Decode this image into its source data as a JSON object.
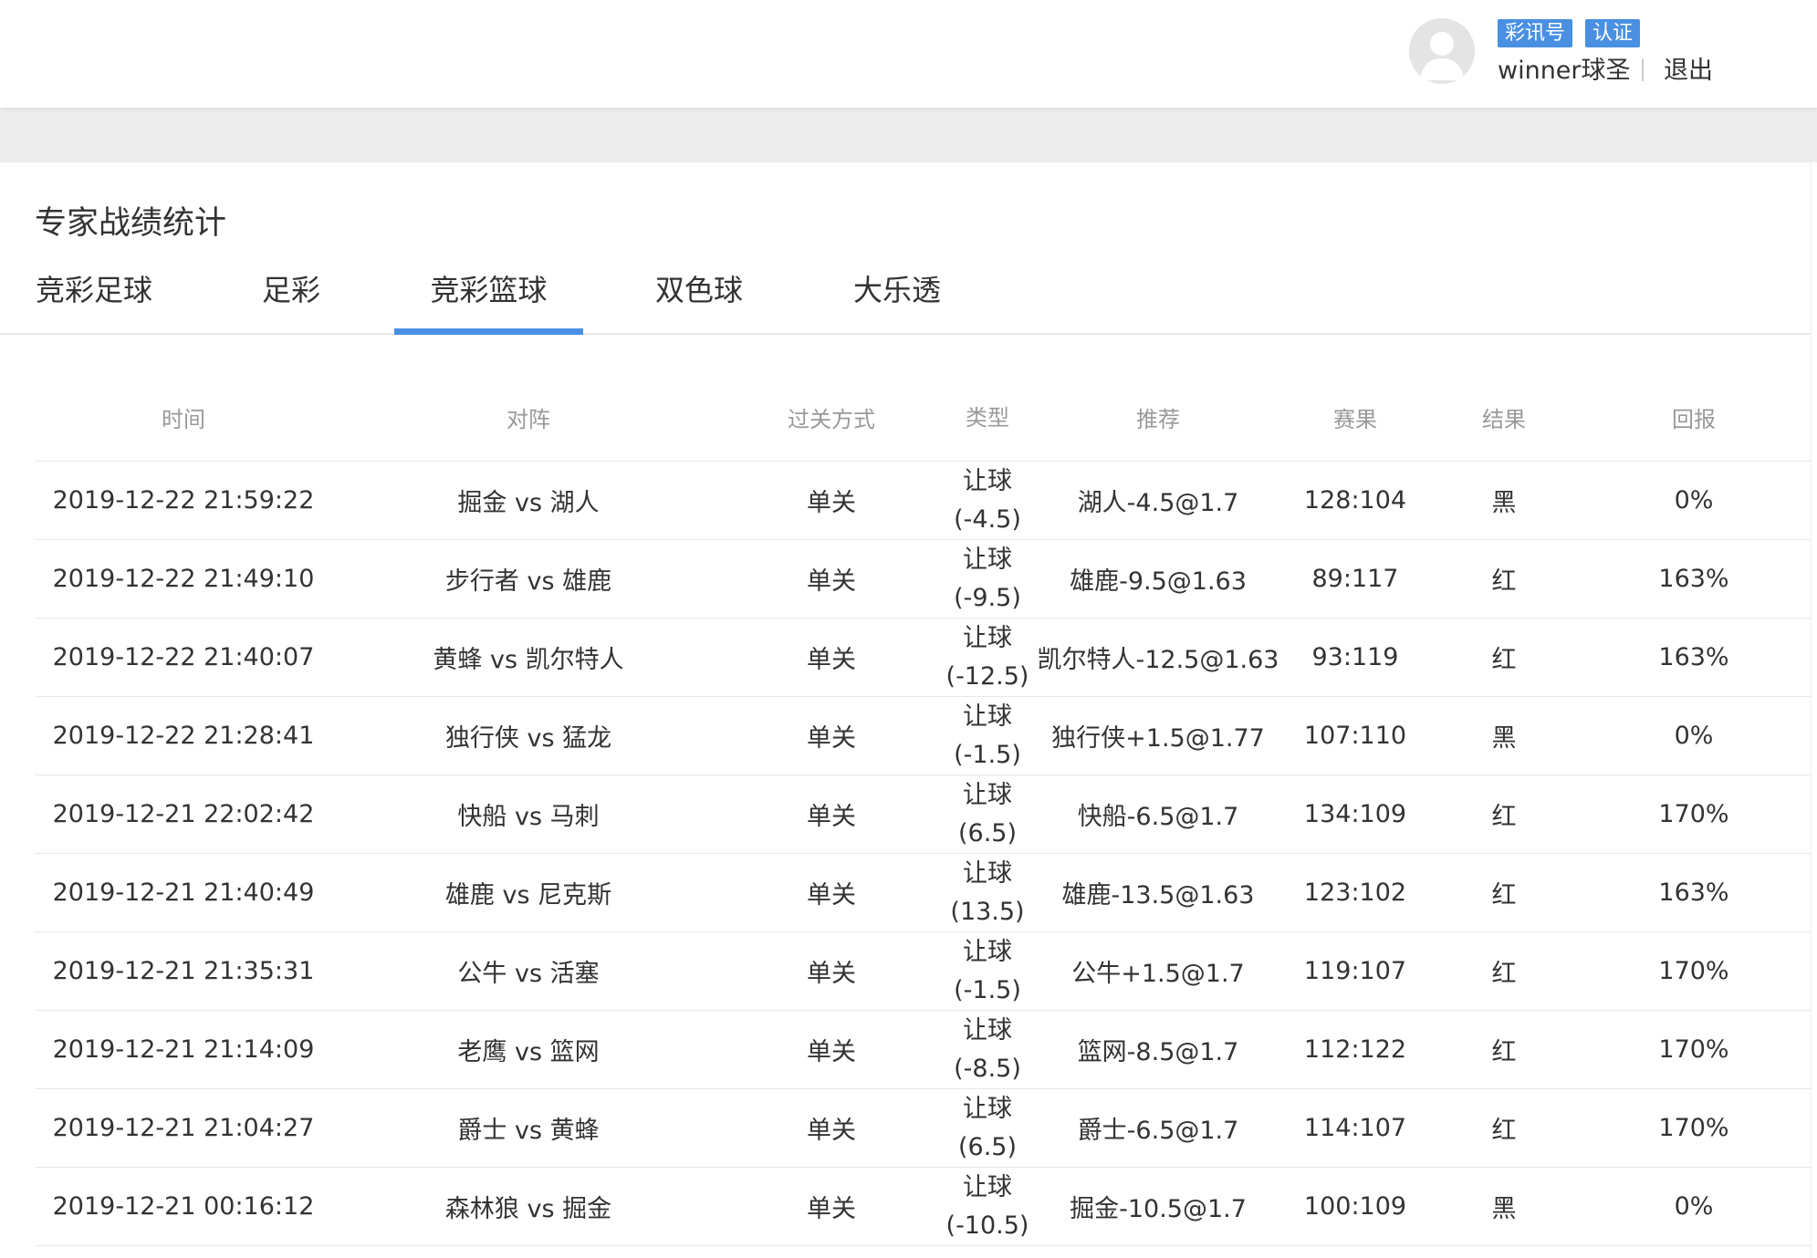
{
  "header": {
    "badges": [
      "彩讯号",
      "认证"
    ],
    "username": "winner球圣",
    "logout": "退出"
  },
  "section": {
    "title": "专家战绩统计"
  },
  "tabs": [
    {
      "label": "竞彩足球",
      "active": false
    },
    {
      "label": "足彩",
      "active": false
    },
    {
      "label": "竞彩篮球",
      "active": true
    },
    {
      "label": "双色球",
      "active": false
    },
    {
      "label": "大乐透",
      "active": false
    }
  ],
  "table": {
    "columns": [
      "时间",
      "对阵",
      "过关方式",
      "类型",
      "推荐",
      "赛果",
      "结果",
      "回报"
    ],
    "rows": [
      {
        "time": "2019-12-22 21:59:22",
        "match": "掘金 vs 湖人",
        "mode": "单关",
        "type": "让球",
        "handicap": "(-4.5)",
        "rec": "湖人-4.5@1.7",
        "score": "128:104",
        "result": "黑",
        "return": "0%"
      },
      {
        "time": "2019-12-22 21:49:10",
        "match": "步行者 vs 雄鹿",
        "mode": "单关",
        "type": "让球",
        "handicap": "(-9.5)",
        "rec": "雄鹿-9.5@1.63",
        "score": "89:117",
        "result": "红",
        "return": "163%"
      },
      {
        "time": "2019-12-22 21:40:07",
        "match": "黄蜂 vs 凯尔特人",
        "mode": "单关",
        "type": "让球",
        "handicap": "(-12.5)",
        "rec": "凯尔特人-12.5@1.63",
        "score": "93:119",
        "result": "红",
        "return": "163%"
      },
      {
        "time": "2019-12-22 21:28:41",
        "match": "独行侠 vs 猛龙",
        "mode": "单关",
        "type": "让球",
        "handicap": "(-1.5)",
        "rec": "独行侠+1.5@1.77",
        "score": "107:110",
        "result": "黑",
        "return": "0%"
      },
      {
        "time": "2019-12-21 22:02:42",
        "match": "快船 vs 马刺",
        "mode": "单关",
        "type": "让球",
        "handicap": "(6.5)",
        "rec": "快船-6.5@1.7",
        "score": "134:109",
        "result": "红",
        "return": "170%"
      },
      {
        "time": "2019-12-21 21:40:49",
        "match": "雄鹿 vs 尼克斯",
        "mode": "单关",
        "type": "让球",
        "handicap": "(13.5)",
        "rec": "雄鹿-13.5@1.63",
        "score": "123:102",
        "result": "红",
        "return": "163%"
      },
      {
        "time": "2019-12-21 21:35:31",
        "match": "公牛 vs 活塞",
        "mode": "单关",
        "type": "让球",
        "handicap": "(-1.5)",
        "rec": "公牛+1.5@1.7",
        "score": "119:107",
        "result": "红",
        "return": "170%"
      },
      {
        "time": "2019-12-21 21:14:09",
        "match": "老鹰 vs 篮网",
        "mode": "单关",
        "type": "让球",
        "handicap": "(-8.5)",
        "rec": "篮网-8.5@1.7",
        "score": "112:122",
        "result": "红",
        "return": "170%"
      },
      {
        "time": "2019-12-21 21:04:27",
        "match": "爵士 vs 黄蜂",
        "mode": "单关",
        "type": "让球",
        "handicap": "(6.5)",
        "rec": "爵士-6.5@1.7",
        "score": "114:107",
        "result": "红",
        "return": "170%"
      },
      {
        "time": "2019-12-21 00:16:12",
        "match": "森林狼 vs 掘金",
        "mode": "单关",
        "type": "让球",
        "handicap": "(-10.5)",
        "rec": "掘金-10.5@1.7",
        "score": "100:109",
        "result": "黑",
        "return": "0%"
      }
    ]
  },
  "colors": {
    "accent": "#4a90e2",
    "header_text": "#999999",
    "body_text": "#333333"
  }
}
